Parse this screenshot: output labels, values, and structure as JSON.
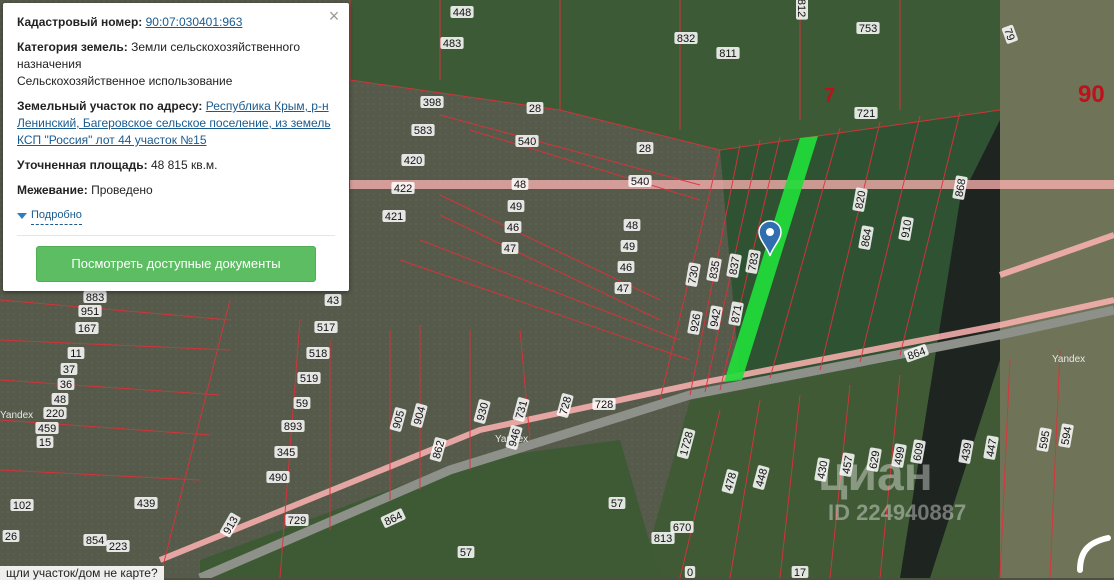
{
  "popup": {
    "cadastral_label": "Кадастровый номер:",
    "cadastral_number": "90:07:030401:963",
    "category_label": "Категория земель:",
    "category_value": "Земли сельскохозяйственного назначения",
    "category_use": "Сельскохозяйственное использование",
    "address_label": "Земельный участок по адресу:",
    "address_value": "Республика Крым, р-н Ленинский, Багеровское сельское поселение, из земель КСП \"Россия\" лот 44 участок №15",
    "area_label": "Уточненная площадь:",
    "area_value": "48 815 кв.м.",
    "survey_label": "Межевание:",
    "survey_value": "Проведено",
    "more_label": "Подробно",
    "docs_button": "Посмотреть доступные документы",
    "close_symbol": "×"
  },
  "bottom_text": "щли участок/дом не карте?",
  "watermark": {
    "brand": "циан",
    "id": "ID 224940887"
  },
  "yandex": "Yandex",
  "big_labels": [
    "7",
    "90"
  ],
  "plot_labels": [
    "448",
    "812",
    "483",
    "832",
    "811",
    "753",
    "79",
    "398",
    "28",
    "583",
    "540",
    "28",
    "420",
    "540",
    "422",
    "48",
    "49",
    "46",
    "47",
    "421",
    "48",
    "49",
    "46",
    "47",
    "721",
    "820",
    "864",
    "910",
    "868",
    "883",
    "951",
    "167",
    "43",
    "517",
    "518",
    "519",
    "11",
    "37",
    "36",
    "48",
    "220",
    "459",
    "15",
    "59",
    "893",
    "345",
    "490",
    "102",
    "26",
    "854",
    "223",
    "439",
    "730",
    "835",
    "837",
    "783",
    "926",
    "942",
    "871",
    "864",
    "905",
    "904",
    "862",
    "930",
    "731",
    "728",
    "728",
    "946",
    "1728",
    "478",
    "448",
    "57",
    "670",
    "813",
    "57",
    "913",
    "729",
    "864",
    "430",
    "457",
    "629",
    "499",
    "609",
    "439",
    "447",
    "595",
    "594",
    "0",
    "17"
  ],
  "colors": {
    "parcel_outline": "#e0303a",
    "selected_parcel": "#22dd3a",
    "road_highlight": "#ffb3b3",
    "marker": "#2f6fb0",
    "button": "#5cbd63"
  }
}
